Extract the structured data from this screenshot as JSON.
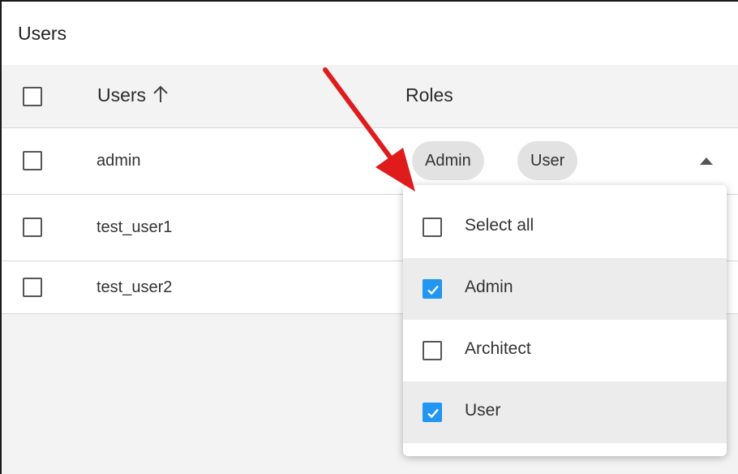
{
  "panel": {
    "title": "Users"
  },
  "table": {
    "columns": {
      "users": "Users",
      "roles": "Roles"
    },
    "rows": [
      {
        "name": "admin",
        "roles": [
          "Admin",
          "User"
        ]
      },
      {
        "name": "test_user1"
      },
      {
        "name": "test_user2"
      }
    ]
  },
  "dropdown": {
    "options": [
      {
        "label": "Select all",
        "checked": false
      },
      {
        "label": "Admin",
        "checked": true
      },
      {
        "label": "Architect",
        "checked": false
      },
      {
        "label": "User",
        "checked": true
      }
    ]
  },
  "colors": {
    "accent": "#2196f3",
    "arrow": "#e01b1b"
  },
  "icons": {
    "sort": "arrow-up-icon",
    "caret": "caret-up-icon"
  }
}
